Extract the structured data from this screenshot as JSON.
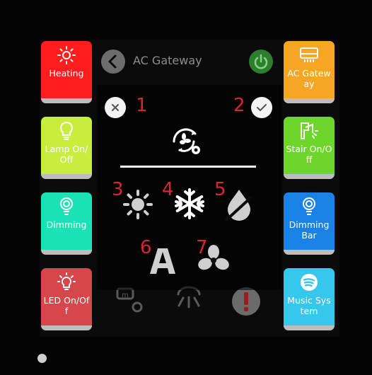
{
  "header": {
    "title": "AC Gateway"
  },
  "left_tiles": [
    {
      "label": "Heating",
      "color": "#ff1d1d",
      "icon": "sun-icon"
    },
    {
      "label": "Lamp On/Off",
      "color": "#c8ee3b",
      "icon": "bulb-icon"
    },
    {
      "label": "Dimming",
      "color": "#19e3b6",
      "icon": "dimmer-bulb-icon"
    },
    {
      "label": "LED On/Off",
      "color": "#d6474c",
      "icon": "led-icon"
    }
  ],
  "right_tiles": [
    {
      "label": "AC Gateway",
      "color": "#f7a524",
      "icon": "ac-unit-icon"
    },
    {
      "label": "Stair On/Off",
      "color": "#6ed62a",
      "icon": "stair-light-icon"
    },
    {
      "label": "Dimming Bar",
      "color": "#1a82e6",
      "icon": "dimmer-bulb-icon"
    },
    {
      "label": "Music System",
      "color": "#37c6ec",
      "icon": "spotify-icon"
    }
  ],
  "mode_dialog": {
    "cancel_number": "1",
    "confirm_number": "2",
    "modes": [
      {
        "number": "3",
        "name": "heat",
        "icon": "sun-icon"
      },
      {
        "number": "4",
        "name": "cool",
        "icon": "snowflake-icon"
      },
      {
        "number": "5",
        "name": "dry",
        "icon": "no-drop-icon"
      },
      {
        "number": "6",
        "name": "auto",
        "icon": "auto-a-icon"
      },
      {
        "number": "7",
        "name": "fan",
        "icon": "fan-icon"
      }
    ]
  },
  "colors": {
    "annotation": "#d8262f",
    "power": "#2f7d2f"
  }
}
